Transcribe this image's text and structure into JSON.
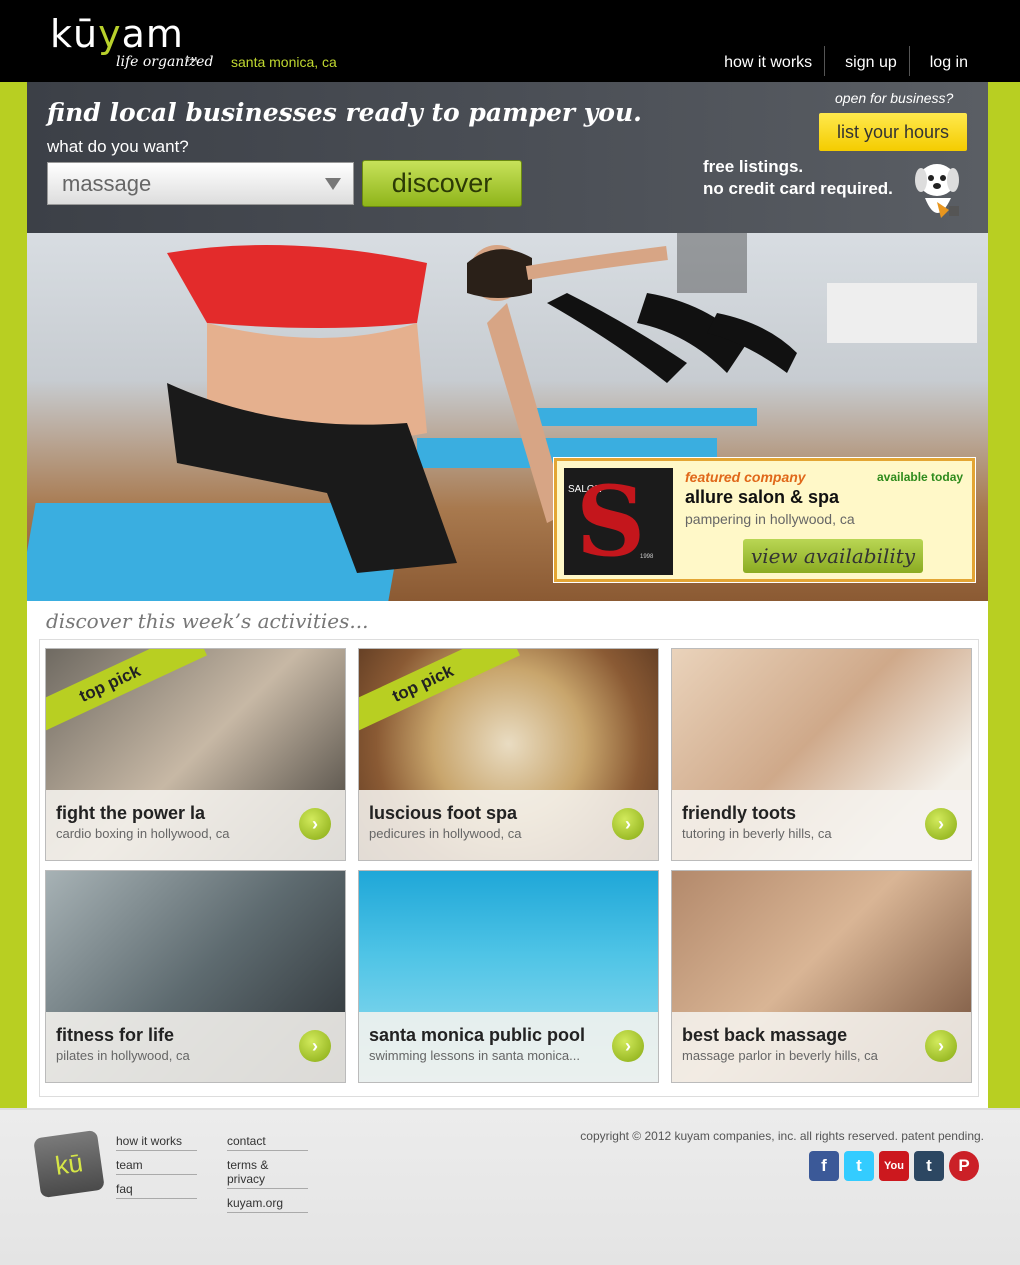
{
  "header": {
    "logo_text": "kuyam",
    "logo_y": "y",
    "tm": "TM",
    "tagline": "life organized",
    "city": "santa monica, ca",
    "nav": [
      "how it works",
      "sign up",
      "log in"
    ]
  },
  "hero": {
    "headline": "find local businesses ready to pamper you.",
    "prompt": "what do you want?",
    "selected_activity": "massage",
    "discover_label": "discover",
    "open_for_business": "open for business?",
    "list_hours_label": "list your hours",
    "free_listings": "free listings.",
    "no_credit_card": "no credit card required."
  },
  "featured": {
    "label": "featured company",
    "availability": "available today",
    "name": "allure salon & spa",
    "description": "pampering in hollywood, ca",
    "button_label": "view availability",
    "logo_word": "SALON",
    "logo_year": "1998"
  },
  "activities": {
    "title": "discover this week’s activities...",
    "ribbon_text": "top pick",
    "cards": [
      {
        "name": "fight the power la",
        "desc": "cardio boxing in hollywood, ca",
        "top_pick": true
      },
      {
        "name": "luscious foot spa",
        "desc": "pedicures in hollywood, ca",
        "top_pick": true
      },
      {
        "name": "friendly toots",
        "desc": "tutoring in beverly hills, ca",
        "top_pick": false
      },
      {
        "name": "fitness for life",
        "desc": "pilates in hollywood, ca",
        "top_pick": false
      },
      {
        "name": "santa monica public pool",
        "desc": "swimming lessons in santa monica...",
        "top_pick": false
      },
      {
        "name": "best back massage",
        "desc": "massage parlor in beverly hills, ca",
        "top_pick": false
      }
    ]
  },
  "footer": {
    "logo_text": "kū",
    "col1": [
      "how it works",
      "team",
      "faq"
    ],
    "col2": [
      "contact",
      "terms & privacy",
      "kuyam.org"
    ],
    "copyright": "copyright © 2012 kuyam companies, inc. all rights reserved. patent pending.",
    "social": [
      {
        "name": "facebook",
        "glyph": "f",
        "color": "#3b5998"
      },
      {
        "name": "twitter",
        "glyph": "t",
        "color": "#33ccff"
      },
      {
        "name": "youtube",
        "glyph": "You",
        "color": "#cc181e"
      },
      {
        "name": "tumblr",
        "glyph": "t",
        "color": "#2c4762"
      },
      {
        "name": "pinterest",
        "glyph": "P",
        "color": "#cb2027"
      }
    ]
  }
}
